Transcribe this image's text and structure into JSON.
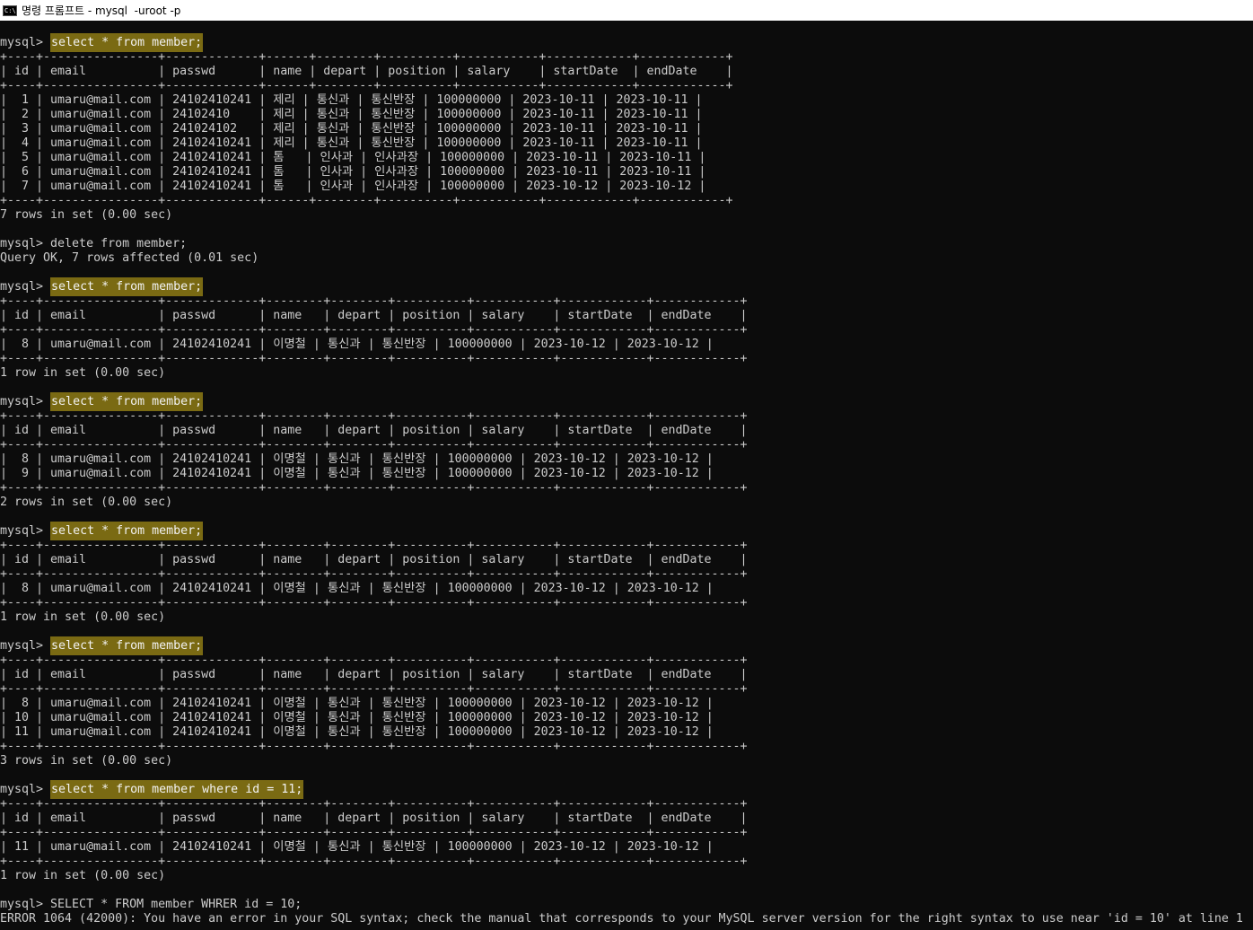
{
  "window": {
    "title": "명령 프롬프트 - mysql  -uroot -p",
    "icon": "cmd-icon"
  },
  "console": {
    "lines": [
      {
        "pre": "mysql> ",
        "hl": "select * from member;"
      },
      {
        "text": "+----+----------------+-------------+------+--------+----------+-----------+------------+------------+"
      },
      {
        "text": "| id | email          | passwd      | name | depart | position | salary    | startDate  | endDate    |"
      },
      {
        "text": "+----+----------------+-------------+------+--------+----------+-----------+------------+------------+"
      },
      {
        "text": "|  1 | umaru@mail.com | 24102410241 | 제리 | 통신과 | 통신반장 | 100000000 | 2023-10-11 | 2023-10-11 |"
      },
      {
        "text": "|  2 | umaru@mail.com | 24102410    | 제리 | 통신과 | 통신반장 | 100000000 | 2023-10-11 | 2023-10-11 |"
      },
      {
        "text": "|  3 | umaru@mail.com | 241024102   | 제리 | 통신과 | 통신반장 | 100000000 | 2023-10-11 | 2023-10-11 |"
      },
      {
        "text": "|  4 | umaru@mail.com | 24102410241 | 제리 | 통신과 | 통신반장 | 100000000 | 2023-10-11 | 2023-10-11 |"
      },
      {
        "text": "|  5 | umaru@mail.com | 24102410241 | 톰   | 인사과 | 인사과장 | 100000000 | 2023-10-11 | 2023-10-11 |"
      },
      {
        "text": "|  6 | umaru@mail.com | 24102410241 | 톰   | 인사과 | 인사과장 | 100000000 | 2023-10-11 | 2023-10-11 |"
      },
      {
        "text": "|  7 | umaru@mail.com | 24102410241 | 톰   | 인사과 | 인사과장 | 100000000 | 2023-10-12 | 2023-10-12 |"
      },
      {
        "text": "+----+----------------+-------------+------+--------+----------+-----------+------------+------------+"
      },
      {
        "text": "7 rows in set (0.00 sec)"
      },
      {
        "text": ""
      },
      {
        "text": "mysql> delete from member;"
      },
      {
        "text": "Query OK, 7 rows affected (0.01 sec)"
      },
      {
        "text": ""
      },
      {
        "pre": "mysql> ",
        "hl": "select * from member;"
      },
      {
        "text": "+----+----------------+-------------+--------+--------+----------+-----------+------------+------------+"
      },
      {
        "text": "| id | email          | passwd      | name   | depart | position | salary    | startDate  | endDate    |"
      },
      {
        "text": "+----+----------------+-------------+--------+--------+----------+-----------+------------+------------+"
      },
      {
        "text": "|  8 | umaru@mail.com | 24102410241 | 이명철 | 통신과 | 통신반장 | 100000000 | 2023-10-12 | 2023-10-12 |"
      },
      {
        "text": "+----+----------------+-------------+--------+--------+----------+-----------+------------+------------+"
      },
      {
        "text": "1 row in set (0.00 sec)"
      },
      {
        "text": ""
      },
      {
        "pre": "mysql> ",
        "hl": "select * from member;"
      },
      {
        "text": "+----+----------------+-------------+--------+--------+----------+-----------+------------+------------+"
      },
      {
        "text": "| id | email          | passwd      | name   | depart | position | salary    | startDate  | endDate    |"
      },
      {
        "text": "+----+----------------+-------------+--------+--------+----------+-----------+------------+------------+"
      },
      {
        "text": "|  8 | umaru@mail.com | 24102410241 | 이명철 | 통신과 | 통신반장 | 100000000 | 2023-10-12 | 2023-10-12 |"
      },
      {
        "text": "|  9 | umaru@mail.com | 24102410241 | 이명철 | 통신과 | 통신반장 | 100000000 | 2023-10-12 | 2023-10-12 |"
      },
      {
        "text": "+----+----------------+-------------+--------+--------+----------+-----------+------------+------------+"
      },
      {
        "text": "2 rows in set (0.00 sec)"
      },
      {
        "text": ""
      },
      {
        "pre": "mysql> ",
        "hl": "select * from member;"
      },
      {
        "text": "+----+----------------+-------------+--------+--------+----------+-----------+------------+------------+"
      },
      {
        "text": "| id | email          | passwd      | name   | depart | position | salary    | startDate  | endDate    |"
      },
      {
        "text": "+----+----------------+-------------+--------+--------+----------+-----------+------------+------------+"
      },
      {
        "text": "|  8 | umaru@mail.com | 24102410241 | 이명철 | 통신과 | 통신반장 | 100000000 | 2023-10-12 | 2023-10-12 |"
      },
      {
        "text": "+----+----------------+-------------+--------+--------+----------+-----------+------------+------------+"
      },
      {
        "text": "1 row in set (0.00 sec)"
      },
      {
        "text": ""
      },
      {
        "pre": "mysql> ",
        "hl": "select * from member;"
      },
      {
        "text": "+----+----------------+-------------+--------+--------+----------+-----------+------------+------------+"
      },
      {
        "text": "| id | email          | passwd      | name   | depart | position | salary    | startDate  | endDate    |"
      },
      {
        "text": "+----+----------------+-------------+--------+--------+----------+-----------+------------+------------+"
      },
      {
        "text": "|  8 | umaru@mail.com | 24102410241 | 이명철 | 통신과 | 통신반장 | 100000000 | 2023-10-12 | 2023-10-12 |"
      },
      {
        "text": "| 10 | umaru@mail.com | 24102410241 | 이명철 | 통신과 | 통신반장 | 100000000 | 2023-10-12 | 2023-10-12 |"
      },
      {
        "text": "| 11 | umaru@mail.com | 24102410241 | 이명철 | 통신과 | 통신반장 | 100000000 | 2023-10-12 | 2023-10-12 |"
      },
      {
        "text": "+----+----------------+-------------+--------+--------+----------+-----------+------------+------------+"
      },
      {
        "text": "3 rows in set (0.00 sec)"
      },
      {
        "text": ""
      },
      {
        "pre": "mysql> ",
        "hl": "select * from member where id = 11;"
      },
      {
        "text": "+----+----------------+-------------+--------+--------+----------+-----------+------------+------------+"
      },
      {
        "text": "| id | email          | passwd      | name   | depart | position | salary    | startDate  | endDate    |"
      },
      {
        "text": "+----+----------------+-------------+--------+--------+----------+-----------+------------+------------+"
      },
      {
        "text": "| 11 | umaru@mail.com | 24102410241 | 이명철 | 통신과 | 통신반장 | 100000000 | 2023-10-12 | 2023-10-12 |"
      },
      {
        "text": "+----+----------------+-------------+--------+--------+----------+-----------+------------+------------+"
      },
      {
        "text": "1 row in set (0.00 sec)"
      },
      {
        "text": ""
      },
      {
        "text": "mysql> SELECT * FROM member WHRER id = 10;"
      },
      {
        "text": "ERROR 1064 (42000): You have an error in your SQL syntax; check the manual that corresponds to your MySQL server version for the right syntax to use near 'id = 10' at line 1"
      }
    ]
  }
}
